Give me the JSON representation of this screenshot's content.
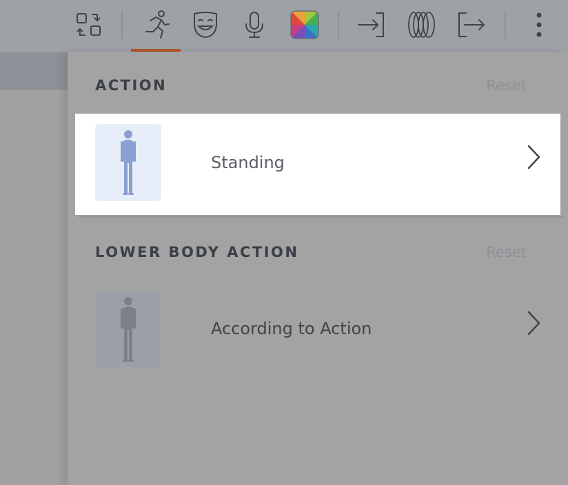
{
  "toolbar": {
    "icons": [
      {
        "name": "swap-icon",
        "label": "swap"
      },
      {
        "name": "action-runner-icon",
        "label": "action"
      },
      {
        "name": "expression-mask-icon",
        "label": "expression"
      },
      {
        "name": "microphone-icon",
        "label": "voice"
      },
      {
        "name": "color-palette-icon",
        "label": "colors"
      },
      {
        "name": "enter-icon",
        "label": "enter"
      },
      {
        "name": "rings-icon",
        "label": "rings"
      },
      {
        "name": "exit-icon",
        "label": "exit"
      },
      {
        "name": "more-vertical-icon",
        "label": "more"
      }
    ],
    "active_tab": "action",
    "accent_color": "#b0572a"
  },
  "sections": [
    {
      "title": "ACTION",
      "reset_label": "Reset",
      "value_label": "Standing",
      "thumbnail": "standing-person-figure"
    },
    {
      "title": "LOWER BODY ACTION",
      "reset_label": "Reset",
      "value_label": "According to Action",
      "thumbnail": "standing-person-figure"
    }
  ]
}
